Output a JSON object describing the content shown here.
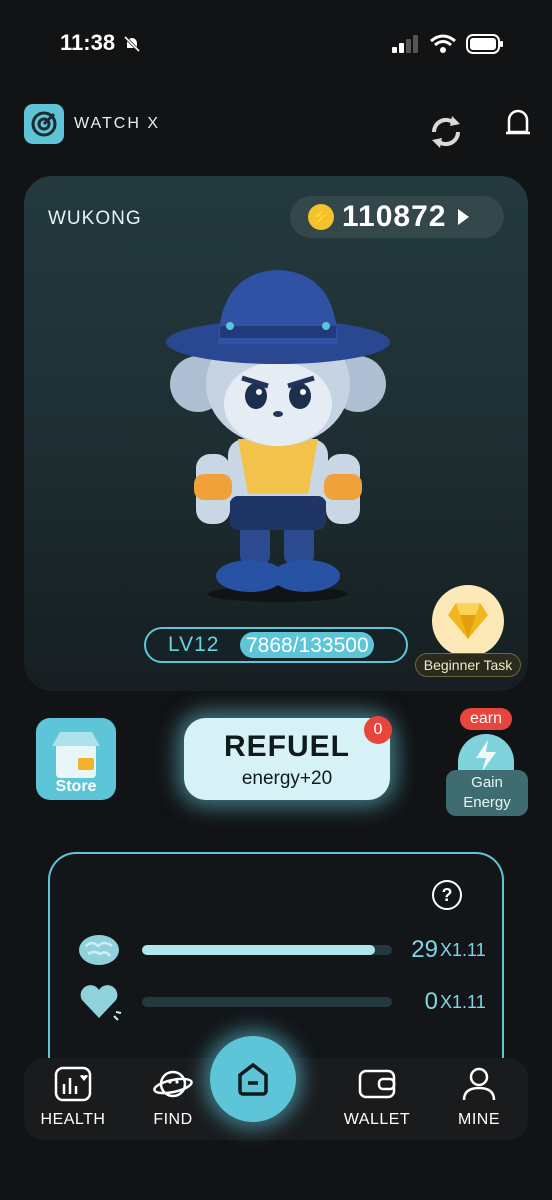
{
  "status": {
    "time": "11:38"
  },
  "app": {
    "logo_text": "WATCH X"
  },
  "character": {
    "name": "WUKONG"
  },
  "coins": {
    "value": "110872"
  },
  "level": {
    "label": "LV12",
    "progress_text": "7868/133500",
    "progress": 0.059
  },
  "task": {
    "label": "Beginner Task"
  },
  "store": {
    "label": "Store"
  },
  "refuel": {
    "title": "REFUEL",
    "subtitle": "energy+20",
    "count": "0"
  },
  "gain_energy": {
    "tag": "earn",
    "line1": "Gain",
    "line2": "Energy"
  },
  "stats": [
    {
      "icon": "brain-icon",
      "value": "29",
      "multiplier": "X1.11",
      "fill": 0.93
    },
    {
      "icon": "heart-icon",
      "value": "0",
      "multiplier": "X1.11",
      "fill": 0.0
    }
  ],
  "nav": {
    "health": "HEALTH",
    "find": "FIND",
    "wallet": "WALLET",
    "mine": "MINE"
  },
  "colors": {
    "accent": "#5ec5d8",
    "badge_red": "#e8453c",
    "coin_gold": "#f4c22c"
  }
}
